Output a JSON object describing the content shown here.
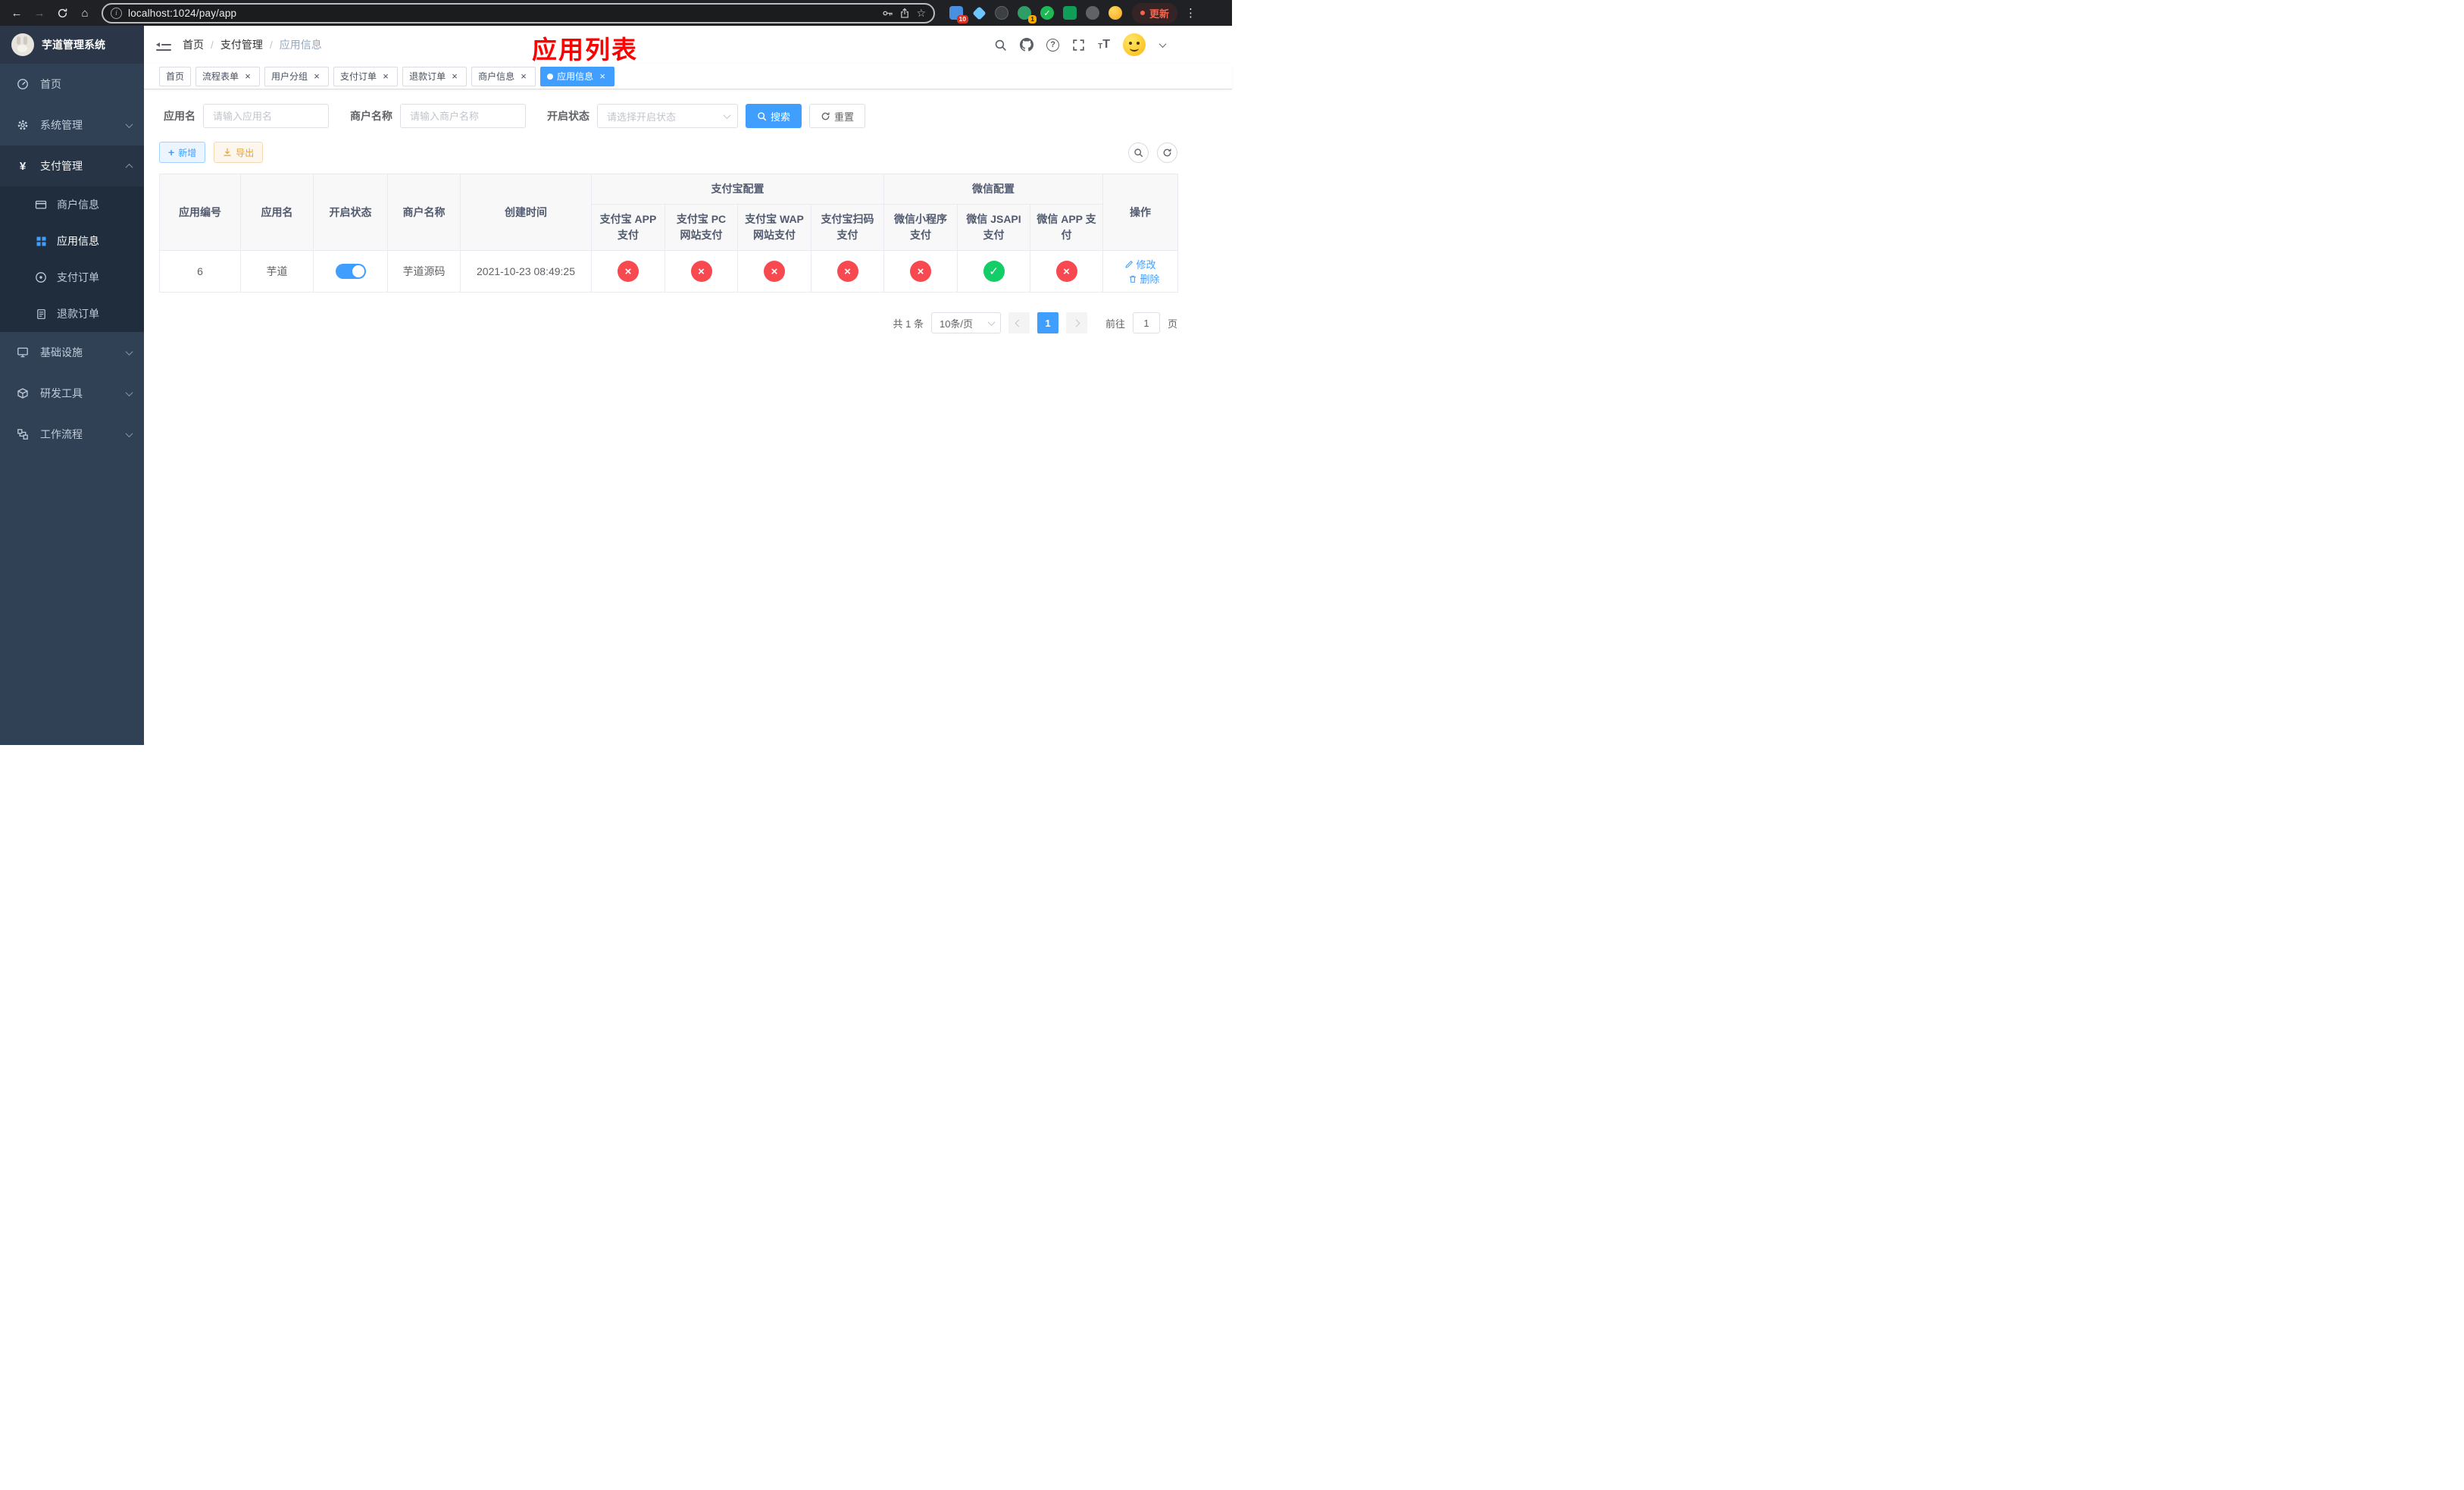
{
  "colors": {
    "primary": "#409eff",
    "success": "#13ce66",
    "danger": "#f7494f",
    "warning": "#e6a23c",
    "overlay-red": "#fe0000",
    "sidebar-bg": "#304156",
    "sidebar-sub-bg": "#1f2d3d",
    "sidebar-text": "#bfcbd9"
  },
  "browser": {
    "url": "localhost:1024/pay/app",
    "update_label": "更新",
    "extension_badge_puzzle": "10",
    "extension_badge_avatar": "1"
  },
  "sidebar": {
    "logo_title": "芋道管理系统",
    "home": "首页",
    "system": "系统管理",
    "payment": "支付管理",
    "merchant_info": "商户信息",
    "app_info": "应用信息",
    "pay_order": "支付订单",
    "refund_order": "退款订单",
    "infra": "基础设施",
    "dev_tools": "研发工具",
    "workflow": "工作流程"
  },
  "breadcrumb": {
    "home": "首页",
    "level1": "支付管理",
    "level2": "应用信息"
  },
  "overlay_title": "应用列表",
  "tabs": [
    {
      "label": "首页"
    },
    {
      "label": "流程表单"
    },
    {
      "label": "用户分组"
    },
    {
      "label": "支付订单"
    },
    {
      "label": "退款订单"
    },
    {
      "label": "商户信息"
    },
    {
      "label": "应用信息"
    }
  ],
  "filters": {
    "app_name_label": "应用名",
    "app_name_placeholder": "请输入应用名",
    "merchant_label": "商户名称",
    "merchant_placeholder": "请输入商户名称",
    "status_label": "开启状态",
    "status_placeholder": "请选择开启状态",
    "search_label": "搜索",
    "reset_label": "重置"
  },
  "toolbar": {
    "add_label": "新增",
    "export_label": "导出"
  },
  "table": {
    "headers": {
      "app_id": "应用编号",
      "app_name": "应用名",
      "status": "开启状态",
      "merchant_name": "商户名称",
      "created_time": "创建时间",
      "alipay_group": "支付宝配置",
      "wechat_group": "微信配置",
      "alipay_app": "支付宝 APP 支付",
      "alipay_pc": "支付宝 PC 网站支付",
      "alipay_wap": "支付宝 WAP 网站支付",
      "alipay_qr": "支付宝扫码支付",
      "wechat_mini": "微信小程序支付",
      "wechat_jsapi": "微信 JSAPI 支付",
      "wechat_app": "微信 APP 支付",
      "actions": "操作"
    },
    "row": {
      "id": "6",
      "name": "芋道",
      "enabled": true,
      "merchant": "芋道源码",
      "created": "2021-10-23 08:49:25",
      "pay_status": [
        "no",
        "no",
        "no",
        "no",
        "no",
        "yes",
        "no"
      ],
      "edit_label": "修改",
      "delete_label": "删除"
    }
  },
  "pagination": {
    "total": "共 1 条",
    "page_size": "10条/页",
    "page": "1",
    "goto": "前往",
    "goto_value": "1",
    "unit": "页"
  }
}
